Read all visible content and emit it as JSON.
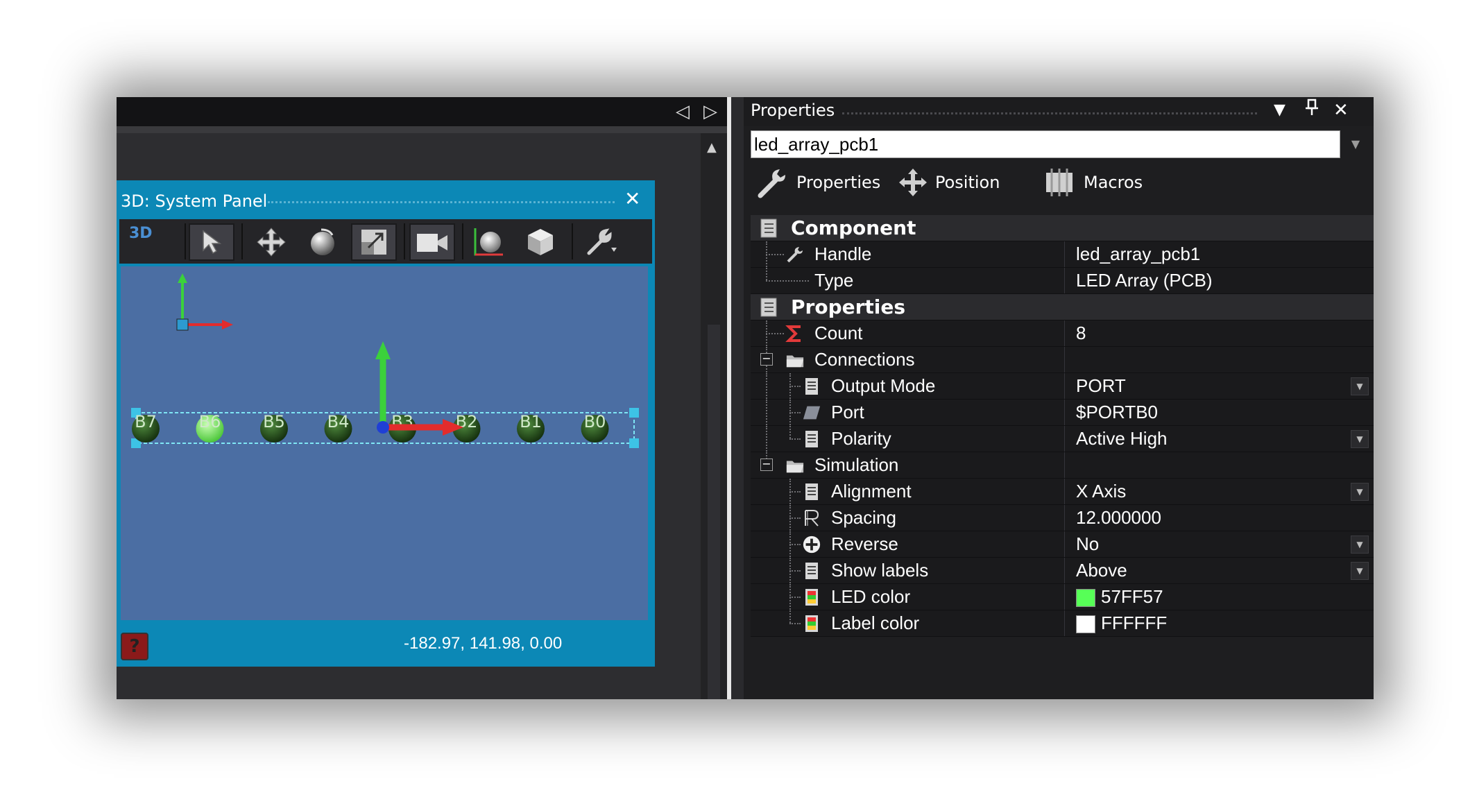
{
  "left_header": {
    "nav_left": "◁",
    "nav_right": "▷"
  },
  "panel3d": {
    "title": "3D: System Panel",
    "close": "✕",
    "toolbar_3d": "3D",
    "help": "?",
    "coordinates": "-182.97, 141.98, 0.00",
    "led_labels": [
      "B7",
      "B6",
      "B5",
      "B4",
      "B3",
      "B2",
      "B1",
      "B0"
    ]
  },
  "properties_panel": {
    "title": "Properties",
    "dropdown_btn": "▼",
    "pin_btn": "📌",
    "close_btn": "✕",
    "selected_object": "led_array_pcb1",
    "tabs": [
      {
        "label": "Properties"
      },
      {
        "label": "Position"
      },
      {
        "label": "Macros"
      }
    ]
  },
  "grid": {
    "component": {
      "label": "Component",
      "handle": {
        "name": "Handle",
        "value": "led_array_pcb1"
      },
      "type": {
        "name": "Type",
        "value": "LED Array (PCB)"
      }
    },
    "properties": {
      "label": "Properties",
      "count": {
        "name": "Count",
        "value": "8"
      },
      "connections": {
        "label": "Connections",
        "expander": "−",
        "output_mode": {
          "name": "Output Mode",
          "value": "PORT"
        },
        "port": {
          "name": "Port",
          "value": "$PORTB0"
        },
        "polarity": {
          "name": "Polarity",
          "value": "Active High"
        }
      },
      "simulation": {
        "label": "Simulation",
        "expander": "−",
        "alignment": {
          "name": "Alignment",
          "value": "X Axis"
        },
        "spacing": {
          "name": "Spacing",
          "value": "12.000000"
        },
        "reverse": {
          "name": "Reverse",
          "value": "No"
        },
        "show_labels": {
          "name": "Show labels",
          "value": "Above"
        },
        "led_color": {
          "name": "LED color",
          "value": "57FF57",
          "swatch": "#57FF57"
        },
        "label_color": {
          "name": "Label color",
          "value": "FFFFFF",
          "swatch": "#FFFFFF"
        }
      }
    }
  }
}
